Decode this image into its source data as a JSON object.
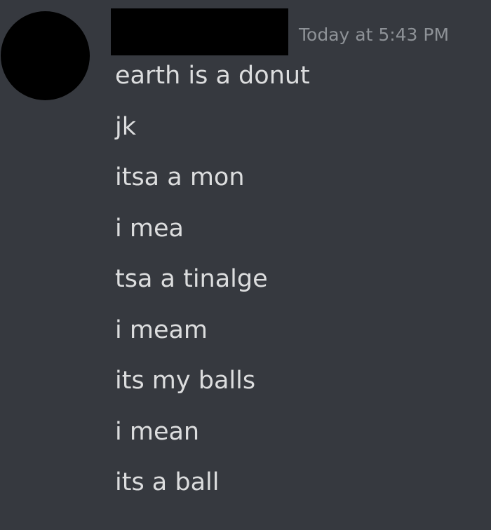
{
  "message": {
    "timestamp": "Today at 5:43 PM",
    "lines": [
      "earth is a donut",
      "jk",
      "itsa a mon",
      "i mea",
      "tsa a tinalge",
      "i meam",
      "its my balls",
      "i mean",
      "its a ball"
    ]
  },
  "colors": {
    "background": "#36393f",
    "message_text": "#dcddde",
    "timestamp_text": "#8e9297",
    "redaction": "#000000"
  }
}
